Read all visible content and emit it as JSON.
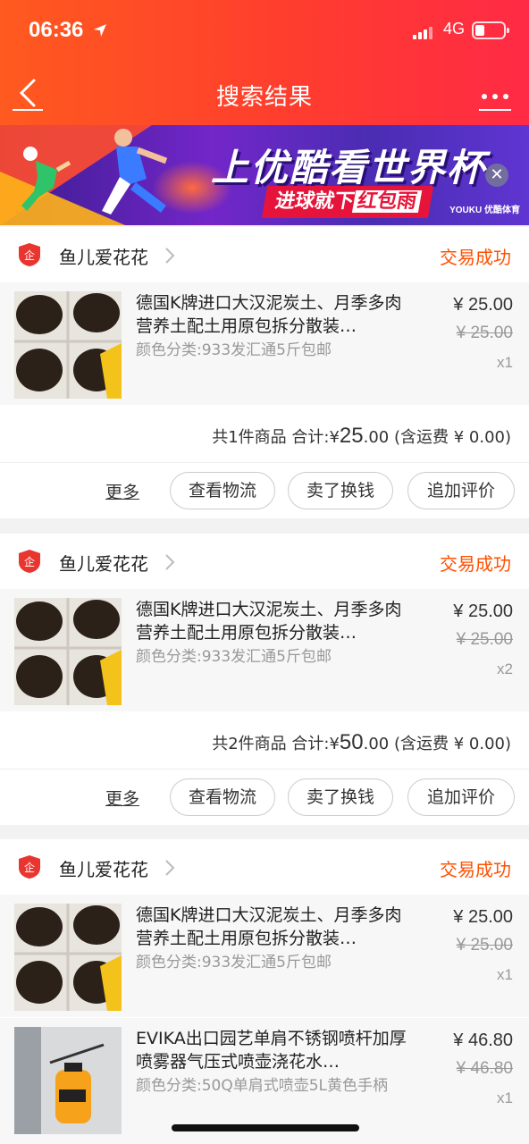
{
  "status_bar": {
    "time": "06:36",
    "network": "4G"
  },
  "nav": {
    "title": "搜索结果"
  },
  "banner": {
    "headline": "上优酷看世界杯",
    "sub_prefix": "进球就下",
    "sub_highlight": "红包雨",
    "brand": "YOUKU 优酷体育"
  },
  "orders": [
    {
      "shop": "鱼儿爱花花",
      "status": "交易成功",
      "items": [
        {
          "title": "德国K牌进口大汉泥炭土、月季多肉营养土配土用原包拆分散装…",
          "sku": "颜色分类:933发汇通5斤包邮",
          "price": "¥ 25.00",
          "original_price": "¥ 25.00",
          "quantity": "x1"
        }
      ],
      "summary_prefix": "共1件商品 合计:¥",
      "summary_int": "25",
      "summary_suffix": ".00 (含运费 ¥ 0.00)",
      "actions": {
        "more": "更多",
        "logistics": "查看物流",
        "resell": "卖了换钱",
        "review": "追加评价"
      }
    },
    {
      "shop": "鱼儿爱花花",
      "status": "交易成功",
      "items": [
        {
          "title": "德国K牌进口大汉泥炭土、月季多肉营养土配土用原包拆分散装…",
          "sku": "颜色分类:933发汇通5斤包邮",
          "price": "¥ 25.00",
          "original_price": "¥ 25.00",
          "quantity": "x2"
        }
      ],
      "summary_prefix": "共2件商品 合计:¥",
      "summary_int": "50",
      "summary_suffix": ".00 (含运费 ¥ 0.00)",
      "actions": {
        "more": "更多",
        "logistics": "查看物流",
        "resell": "卖了换钱",
        "review": "追加评价"
      }
    },
    {
      "shop": "鱼儿爱花花",
      "status": "交易成功",
      "items": [
        {
          "title": "德国K牌进口大汉泥炭土、月季多肉营养土配土用原包拆分散装…",
          "sku": "颜色分类:933发汇通5斤包邮",
          "price": "¥ 25.00",
          "original_price": "¥ 25.00",
          "quantity": "x1"
        },
        {
          "title": "EVIKA出口园艺单肩不锈钢喷杆加厚喷雾器气压式喷壶浇花水…",
          "sku": "颜色分类:50Q单肩式喷壶5L黄色手柄",
          "price": "¥ 46.80",
          "original_price": "¥ 46.80",
          "quantity": "x1"
        }
      ]
    }
  ],
  "colors": {
    "accent": "#ff5000",
    "header_start": "#ff5a1f",
    "header_end": "#ff2a45"
  },
  "icons": [
    "location-arrow-icon",
    "signal-icon",
    "battery-icon",
    "back-arrow-icon",
    "more-dots-icon",
    "banner-close-icon",
    "shop-badge-icon",
    "chevron-right-icon"
  ]
}
